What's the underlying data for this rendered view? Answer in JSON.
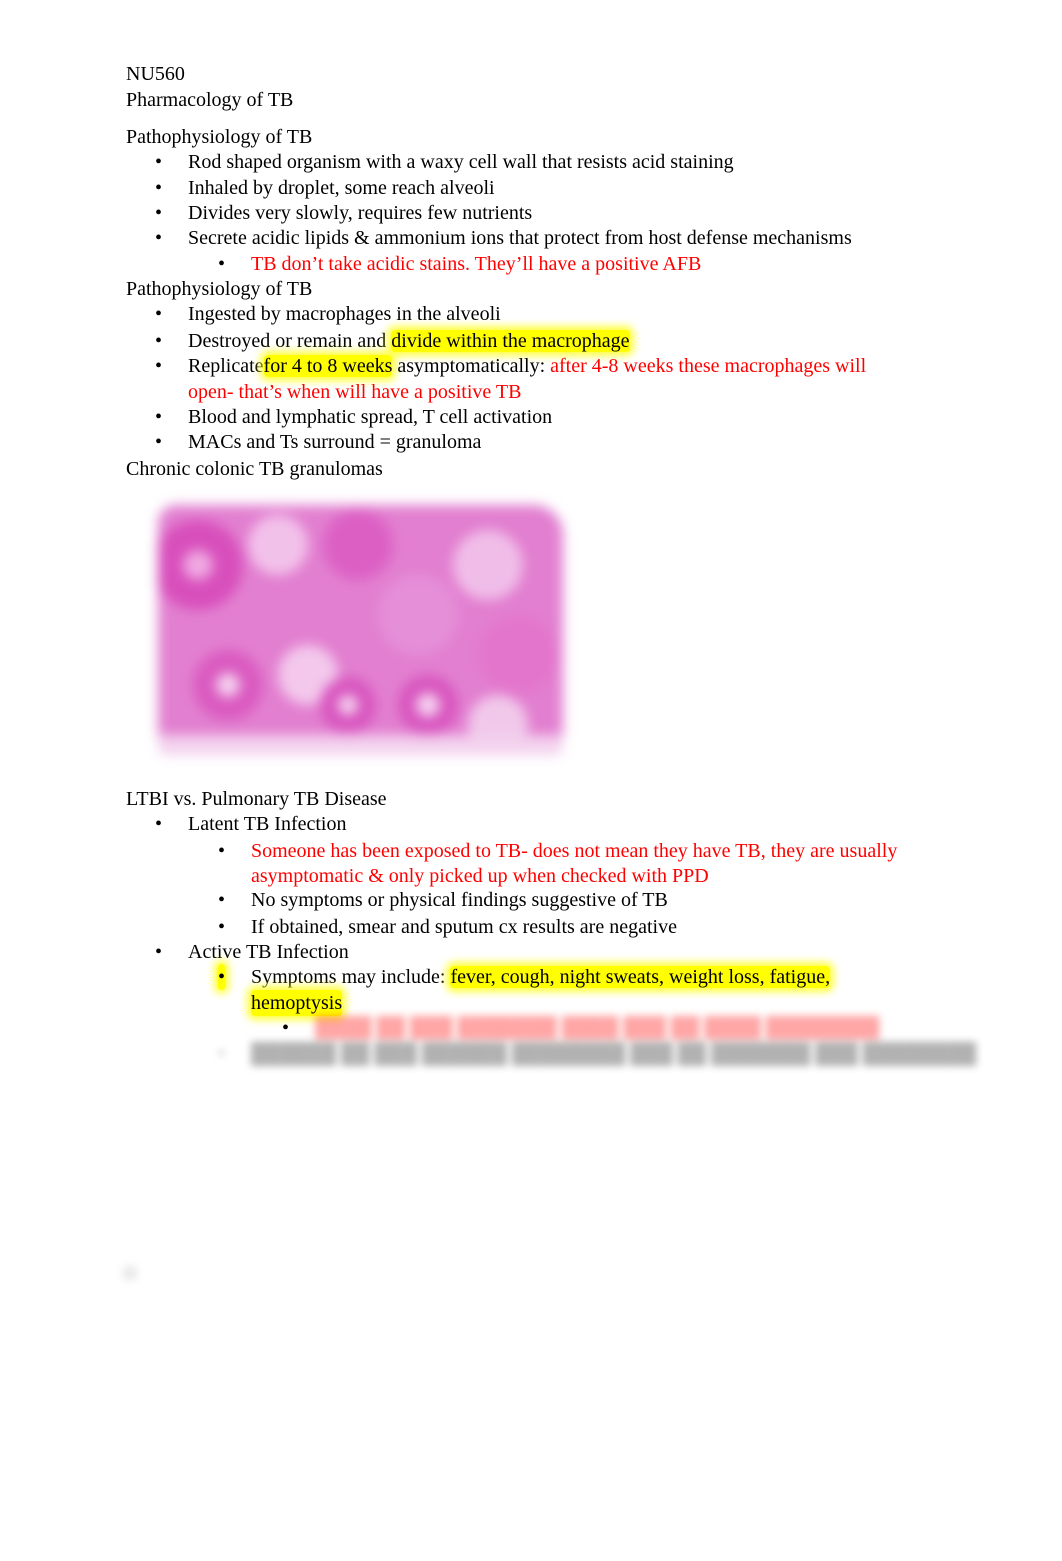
{
  "doc": {
    "course": "NU560",
    "title": "Pharmacology of TB",
    "section1": {
      "heading": "Pathophysiology of TB",
      "items": [
        "Rod shaped organism with a waxy cell wall that resists acid staining",
        "Inhaled by droplet, some reach alveoli",
        "Divides very slowly, requires few nutrients",
        "Secrete acidic lipids & ammonium ions that protect from host defense mechanisms"
      ],
      "note": "TB don’t take acidic stains. They’ll have a positive AFB"
    },
    "section2": {
      "heading": "Pathophysiology of TB",
      "item1": "Ingested by macrophages in the alveoli",
      "item2_pre": "Destroyed or remain and ",
      "item2_hl": "divide within the macrophage",
      "item3_pre": "Replicate",
      "item3_hl": "for 4 to 8 weeks",
      "item3_mid": " asymptomatically: ",
      "item3_red1": "after 4-8 weeks these macrophages will",
      "item3_red2": "open- that’s when will have a positive TB",
      "item4": "Blood and lymphatic spread, T cell activation",
      "item5": "MACs and Ts surround = granuloma"
    },
    "figure": {
      "caption": "Chronic colonic TB granulomas",
      "description": "histology-image"
    },
    "section3": {
      "heading": "LTBI vs. Pulmonary TB Disease",
      "latent_label": "Latent TB Infection",
      "latent_red1": "Someone has been exposed to TB- does not mean they have TB, they are usually",
      "latent_red2": "asymptomatic & only picked up when checked with PPD",
      "latent_item2": "No symptoms or physical findings suggestive of TB",
      "latent_item3": "If obtained, smear and sputum cx results are negative",
      "active_label": "Active TB Infection",
      "active_pre": "Symptoms may include: ",
      "active_hl1": "fever, cough, night sweats, weight loss, fatigue,",
      "active_hl2": "hemoptysis",
      "blurred_red": "████ ██ ███ ███████ ████ ███ ██ ████ ████████",
      "blurred_black": "██████ ██ ███ ██████ ████████ ███ ██ ███████ ███ ████████"
    },
    "bullet": "•"
  }
}
